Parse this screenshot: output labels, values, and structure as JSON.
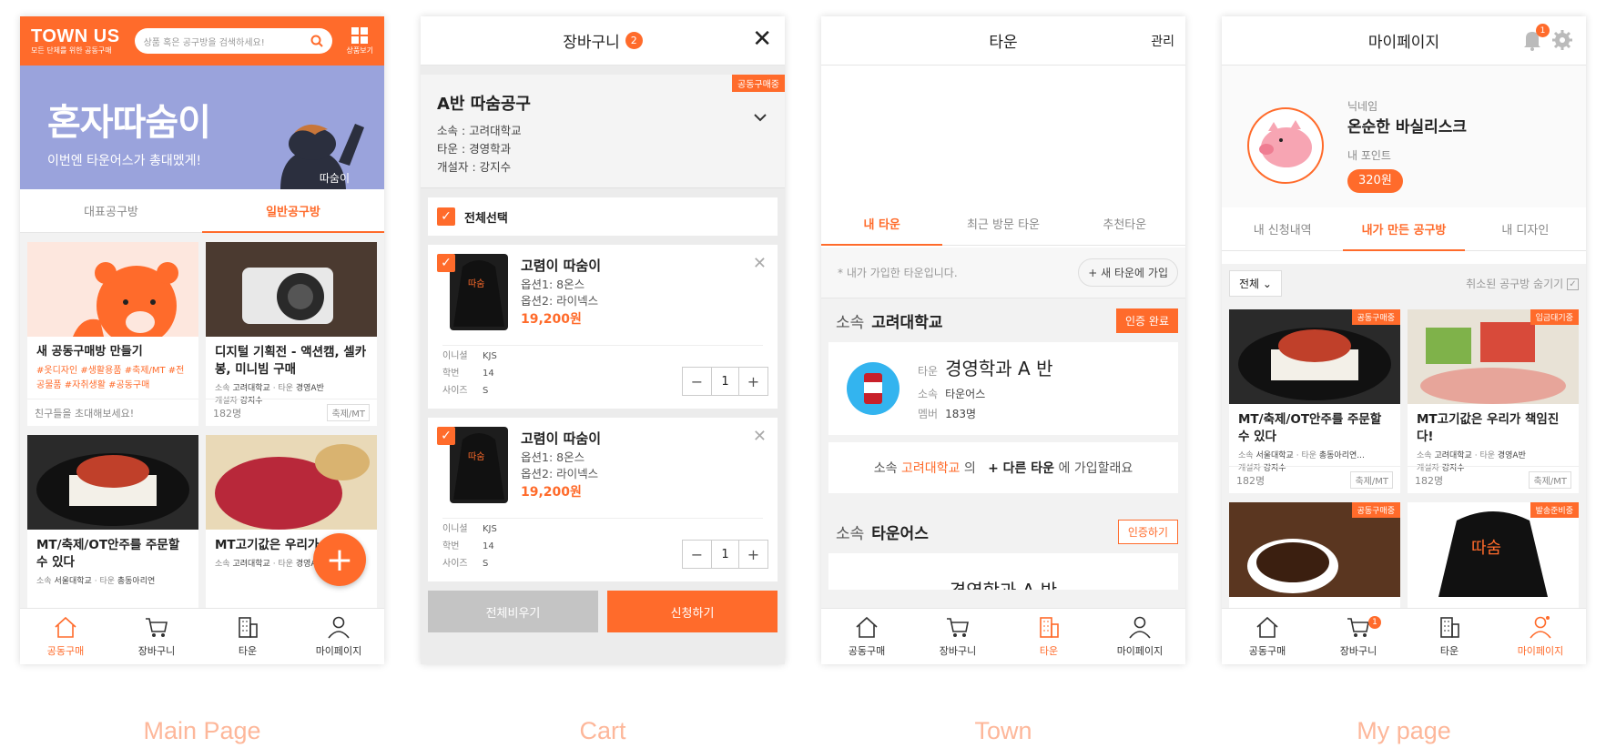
{
  "captions": [
    "Main Page",
    "Cart",
    "Town",
    "My page"
  ],
  "nav": {
    "home": "공동구매",
    "cart": "장바구니",
    "town": "타운",
    "mypage": "마이페이지"
  },
  "colors": {
    "accent": "#ff6b2b",
    "banner": "#9aa3dc",
    "caption": "#fdb79a"
  },
  "main": {
    "logo": "TOWN US",
    "logo_sub": "모든 단체를 위한 공동구매",
    "search_placeholder": "상품 혹은 공구방을 검색하세요!",
    "browse_label": "상품보기",
    "banner_title": "혼자따숨이",
    "banner_sub": "이번엔 타운어스가 총대멨게!",
    "banner_char": "따숨이",
    "tabs": [
      "대표공구방",
      "일반공구방"
    ],
    "new_card": {
      "title": "새 공동구매방 만들기",
      "tags": "#옷디자인 #생활용품 #축제/MT #전공물품 #자취생활 #공동구매",
      "foot": "친구들을 초대해보세요!"
    },
    "card1": {
      "title": "디지털 기획전 - 액션캠, 셀카봉, 미니빔 구매",
      "school_l": "소속",
      "school": "고려대학교",
      "town_l": "타운",
      "town": "경영A반",
      "owner_l": "개설자",
      "owner": "강지수",
      "count": "182명",
      "tag": "축제/MT"
    },
    "card2": {
      "title": "MT/축제/OT안주를 주문할 수 있다",
      "school_l": "소속",
      "school": "서울대학교",
      "town_l": "타운",
      "town": "총동아리연"
    },
    "card3": {
      "title": "MT고기값은 우리가 다!",
      "school_l": "소속",
      "school": "고려대학교",
      "town_l": "타운",
      "town": "경영A반"
    },
    "fab": "+"
  },
  "cart": {
    "title": "장바구니",
    "badge": "2",
    "close": "✕",
    "group": {
      "ribbon": "공동구매중",
      "name": "A반 따숨공구",
      "school": "소속 : 고려대학교",
      "town": "타운 : 경영학과",
      "owner": "개설자 : 강지수"
    },
    "select_all": "전체선택",
    "items": [
      {
        "name": "고렴이 따숨이",
        "opt1": "옵션1: 8온스",
        "opt2": "옵션2: 라이넥스",
        "price": "19,200원",
        "l1": "이니셜",
        "v1": "KJS",
        "l2": "학번",
        "v2": "14",
        "l3": "사이즈",
        "v3": "S",
        "qty": "1"
      },
      {
        "name": "고렴이 따숨이",
        "opt1": "옵션1: 8온스",
        "opt2": "옵션2: 라이넥스",
        "price": "19,200원",
        "l1": "이니셜",
        "v1": "KJS",
        "l2": "학번",
        "v2": "14",
        "l3": "사이즈",
        "v3": "S",
        "qty": "1"
      }
    ],
    "clear_all": "전체비우기",
    "apply": "신청하기"
  },
  "town": {
    "title": "타운",
    "manage": "관리",
    "tabs": [
      "내 타운",
      "최근 방문 타운",
      "추천타운"
    ],
    "notice": "* 내가 가입한 타운입니다.",
    "join_new": "+ 새 타운에 가입",
    "sec1_label": "소속",
    "sec1_name": "고려대학교",
    "verified": "인증 완료",
    "card": {
      "town_l": "타운",
      "town": "경영학과 A 반",
      "school_l": "소속",
      "school": "타운어스",
      "member_l": "멤버",
      "member": "183명"
    },
    "join_text_a": "소속",
    "join_text_b": "고려대학교",
    "join_text_c": "의",
    "join_text_d": "+ 다른 타운",
    "join_text_e": "에 가입할래요",
    "sec2_label": "소속",
    "sec2_name": "타운어스",
    "verify": "인증하기",
    "peek": "경영학과 A 반"
  },
  "my": {
    "title": "마이페이지",
    "bell_badge": "1",
    "nick_label": "닉네임",
    "nick": "온순한 바실리스크",
    "points_label": "내 포인트",
    "points": "320원",
    "tabs": [
      "내 신청내역",
      "내가 만든 공구방",
      "내 디자인"
    ],
    "filter": "전체",
    "hide_label": "취소된 공구방 숨기기",
    "card1": {
      "ribbon": "공동구매중",
      "title": "MT/축제/OT안주를 주문할 수 있다",
      "school_l": "소속",
      "school": "서울대학교",
      "town_l": "타운",
      "town": "총동아리연...",
      "owner_l": "개설자",
      "owner": "강지수",
      "count": "182명",
      "tag": "축제/MT"
    },
    "card2": {
      "ribbon": "입금대기중",
      "title": "MT고기값은 우리가 책임진다!",
      "school_l": "소속",
      "school": "고려대학교",
      "town_l": "타운",
      "town": "경영A반",
      "owner_l": "개설자",
      "owner": "강지수",
      "count": "182명",
      "tag": "축제/MT"
    },
    "card3": {
      "ribbon": "공동구매중"
    },
    "card4": {
      "ribbon": "발송준비중"
    },
    "cart_badge": "1"
  }
}
